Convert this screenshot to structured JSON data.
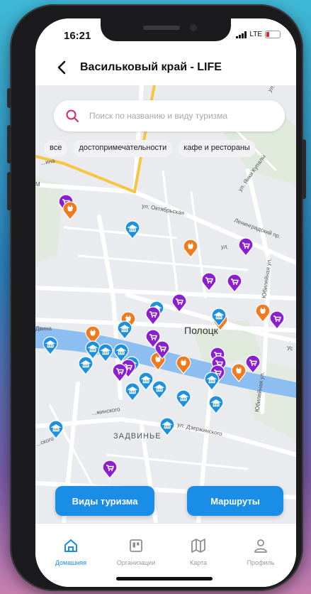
{
  "status": {
    "time": "16:21",
    "network": "LTE"
  },
  "header": {
    "title": "Васильковый край - LIFE"
  },
  "search": {
    "placeholder": "Поиск по названию и виду туризма"
  },
  "filters": [
    "все",
    "достопримечательности",
    "кафе и рестораны"
  ],
  "map": {
    "labels": {
      "city": "Полоцк",
      "district": "ЗАДВИНЬЕ",
      "river": "Двина",
      "street_oktyabrskaya": "ул. Октябрьская",
      "street_leningradskaya": "Ленинградский пр.",
      "street_kupaly": "ул. Янки Купалы",
      "street_dzerzhinskogo": "ул. Дзержинского",
      "street_yubileinaya": "Юбилейная ул.",
      "street_yubileinaya2": "Юбилейная ул.",
      "street_partial_left": "...жинского",
      "street_partial_top": "ул. Ку...",
      "street_partial_vina": "Двина",
      "street_partial_ina": "...ина",
      "street_partial_ul": "ул.",
      "street_partial_us": "Ус",
      "street_partial_ls": "...ского",
      "street_partial_m": "М"
    },
    "pin_colors": {
      "sight": "#1e90e0",
      "cafe": "#f07a1e",
      "shop": "#8a1fd0"
    }
  },
  "actions": {
    "tourism_types": "Виды туризма",
    "routes": "Маршруты"
  },
  "tabs": [
    {
      "label": "Домашняя",
      "icon": "home-icon",
      "active": true
    },
    {
      "label": "Организации",
      "icon": "organizations-icon",
      "active": false
    },
    {
      "label": "Карта",
      "icon": "map-icon",
      "active": false
    },
    {
      "label": "Профиль",
      "icon": "profile-icon",
      "active": false
    }
  ]
}
